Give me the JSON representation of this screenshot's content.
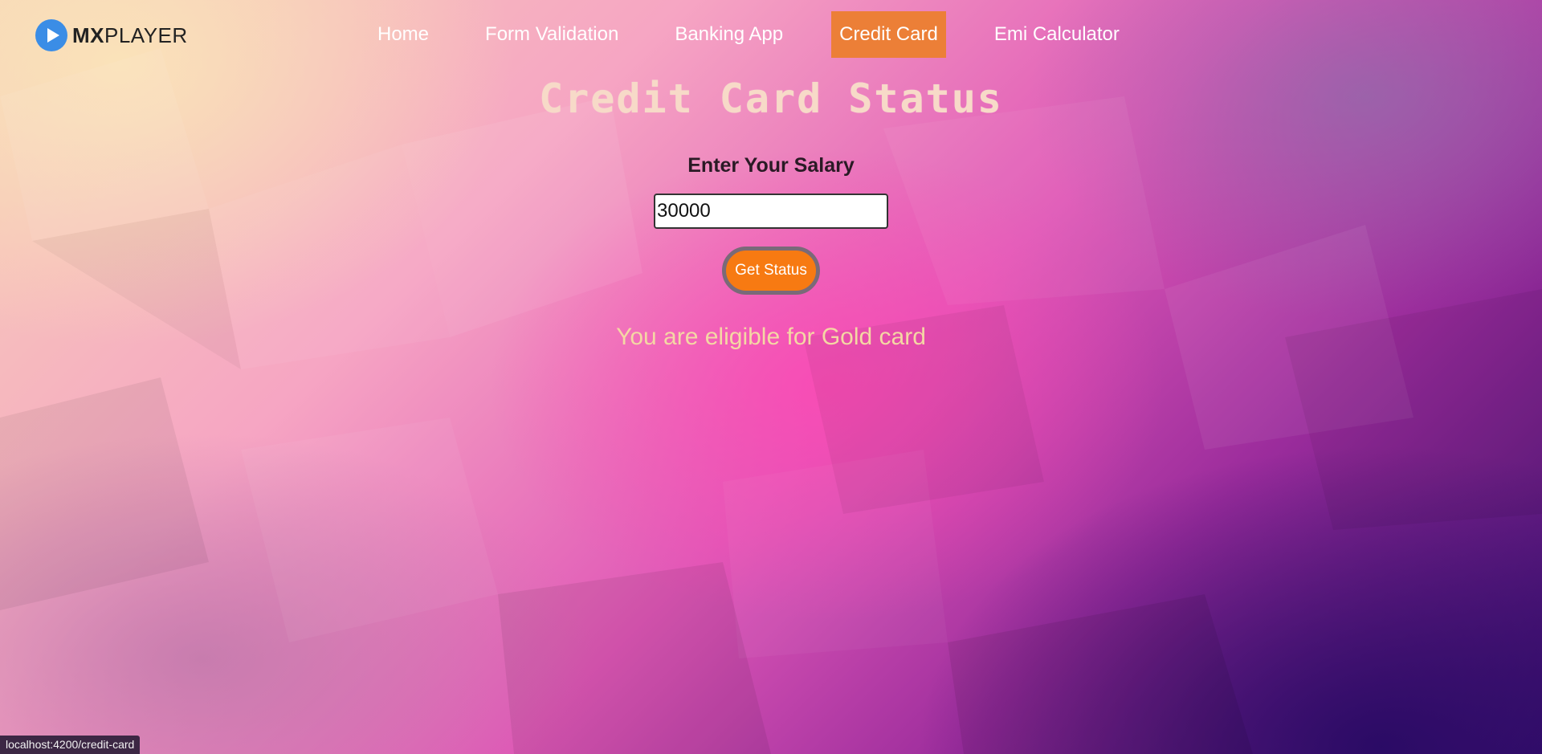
{
  "brand": {
    "logo_bold": "MX",
    "logo_rest": "PLAYER"
  },
  "nav": {
    "items": [
      {
        "label": "Home"
      },
      {
        "label": "Form Validation"
      },
      {
        "label": "Banking App"
      },
      {
        "label": "Credit Card",
        "active": true
      },
      {
        "label": "Emi Calculator"
      }
    ]
  },
  "main": {
    "title": "Credit Card Status",
    "salary_label": "Enter Your Salary",
    "salary_value": "30000",
    "button_label": "Get Status",
    "result_text": "You are eligible for Gold card"
  },
  "statusbar": {
    "url": "localhost:4200/credit-card"
  },
  "colors": {
    "active_nav": "#ec7f37",
    "button": "#f77a12",
    "result_text": "#f4d7a4",
    "title_text": "#f7dac8"
  },
  "icons": {
    "logo": "play-circle-icon"
  }
}
